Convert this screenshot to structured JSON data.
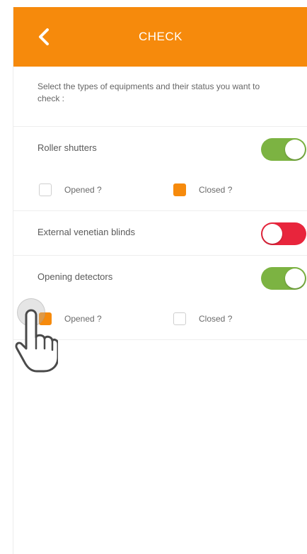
{
  "header": {
    "title": "CHECK",
    "back_icon": "chevron-left-icon",
    "bg_color": "#f68a0c"
  },
  "intro": {
    "text": "Select the types of equipments and their status you want to check :"
  },
  "sections": [
    {
      "label": "Roller shutters",
      "toggle_on": true,
      "options": [
        {
          "label": "Opened ?",
          "checked": false
        },
        {
          "label": "Closed ?",
          "checked": true
        }
      ]
    },
    {
      "label": "External venetian blinds",
      "toggle_on": false
    },
    {
      "label": "Opening detectors",
      "toggle_on": true,
      "options": [
        {
          "label": "Opened ?",
          "checked": true
        },
        {
          "label": "Closed ?",
          "checked": false
        }
      ]
    }
  ],
  "colors": {
    "toggle_on": "#7cb342",
    "toggle_off": "#e8253c",
    "check_accent": "#f68a0c"
  },
  "cursor": {
    "icon": "hand-pointer-icon"
  }
}
